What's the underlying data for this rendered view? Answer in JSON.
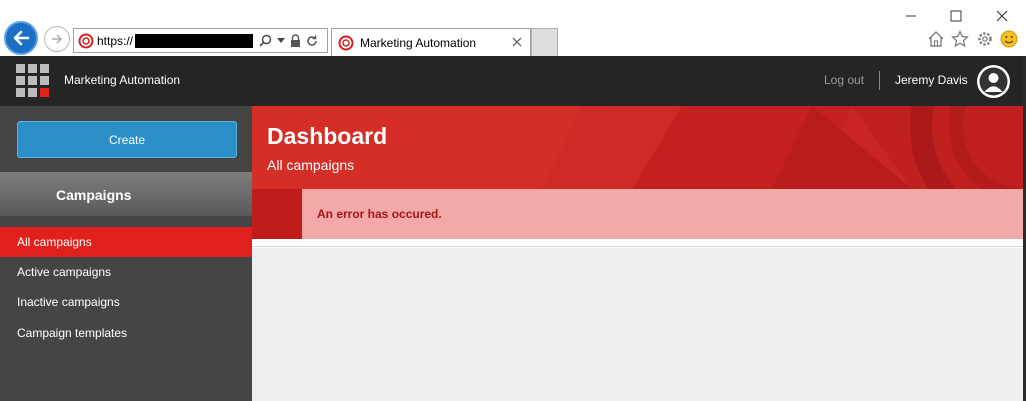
{
  "browser": {
    "url_prefix": "https://",
    "tab_title": "Marketing Automation"
  },
  "header": {
    "app_title": "Marketing Automation",
    "logout_label": "Log out",
    "user_name": "Jeremy Davis"
  },
  "sidebar": {
    "create_label": "Create",
    "section_title": "Campaigns",
    "items": [
      {
        "label": "All campaigns"
      },
      {
        "label": "Active campaigns"
      },
      {
        "label": "Inactive campaigns"
      },
      {
        "label": "Campaign templates"
      }
    ]
  },
  "main": {
    "title": "Dashboard",
    "subtitle": "All campaigns",
    "error_message": "An error has occured."
  },
  "colors": {
    "accent_red": "#e0201c",
    "create_blue": "#2a8fc6",
    "header_dark": "#252525",
    "sidebar_dark": "#454545",
    "error_bg": "#f2a9a8",
    "error_text": "#a81616"
  },
  "icons": [
    "back-icon",
    "forward-icon",
    "site-icon",
    "search-icon",
    "dropdown-icon",
    "lock-icon",
    "refresh-icon",
    "close-tab-icon",
    "minimize-icon",
    "maximize-icon",
    "close-window-icon",
    "home-icon",
    "favorites-star-icon",
    "settings-gear-icon",
    "smiley-feedback-icon",
    "app-logo-grid-icon",
    "user-avatar-icon"
  ]
}
